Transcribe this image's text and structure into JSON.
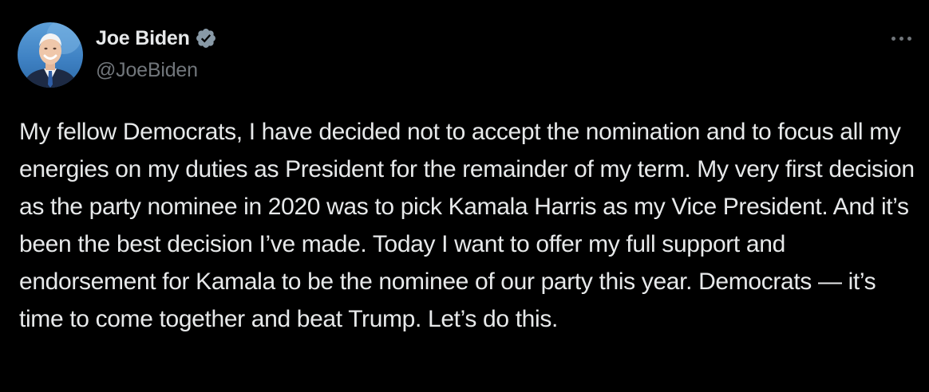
{
  "tweet": {
    "author": {
      "display_name": "Joe Biden",
      "handle": "@JoeBiden",
      "verified": true,
      "verified_color": "#8899a6"
    },
    "more_menu_icon": "more-horizontal-icon",
    "text": "My fellow Democrats, I have decided not to accept the nomination and to focus all my energies on my duties as President for the remainder of my term. My very first decision as the party nominee in 2020 was to pick Kamala Harris as my Vice President. And it’s been the best decision I’ve made. Today I want to offer my full support and endorsement for Kamala to be the nominee of our party this year. Democrats — it’s time to come together and beat Trump. Let’s do this."
  },
  "colors": {
    "background": "#000000",
    "text_primary": "#e7e9ea",
    "text_secondary": "#71767b"
  }
}
